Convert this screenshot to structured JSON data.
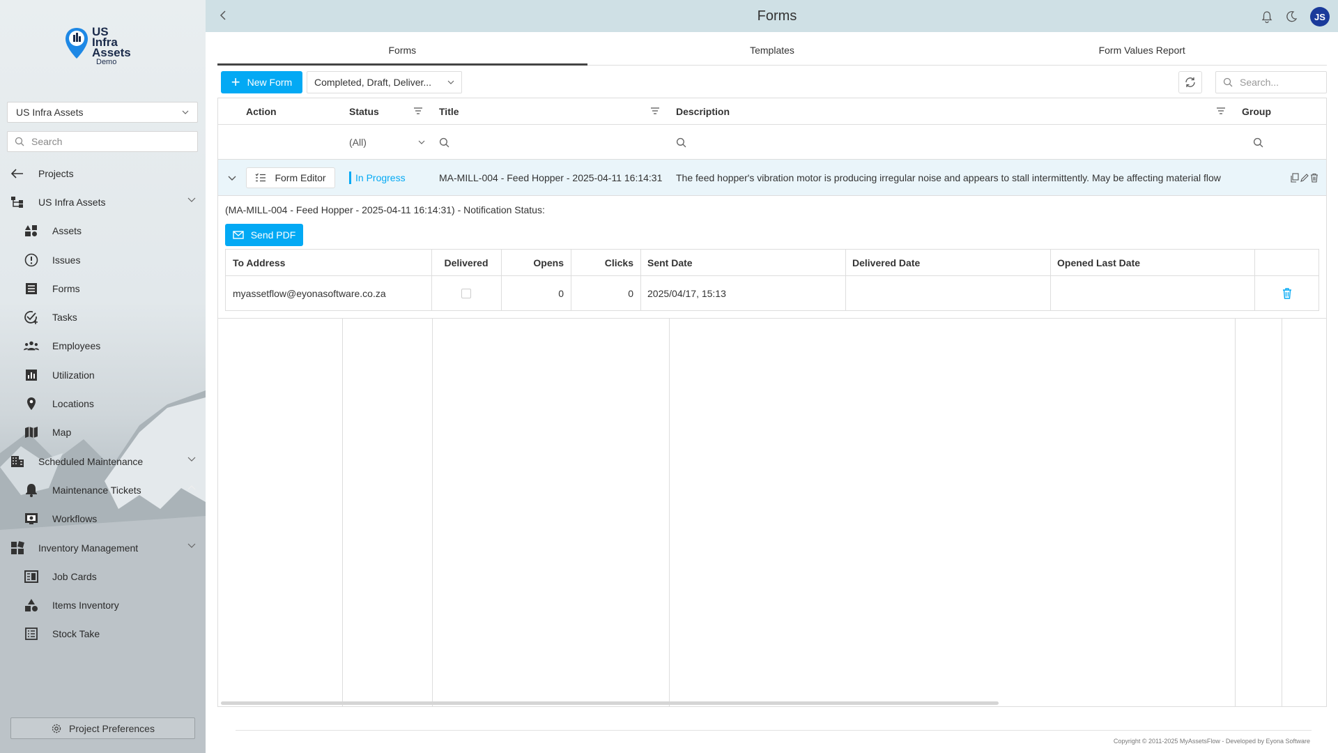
{
  "brand": {
    "line1": "US",
    "line2": "Infra",
    "line3": "Assets",
    "demo": "Demo"
  },
  "sidebar": {
    "project_select": "US Infra Assets",
    "search_placeholder": "Search",
    "items": [
      {
        "label": "Projects",
        "icon": "arrow-left-icon"
      },
      {
        "label": "US Infra Assets",
        "icon": "hierarchy-icon"
      },
      {
        "label": "Assets",
        "icon": "assets-icon"
      },
      {
        "label": "Issues",
        "icon": "alert-circle-icon"
      },
      {
        "label": "Forms",
        "icon": "form-icon"
      },
      {
        "label": "Tasks",
        "icon": "task-icon"
      },
      {
        "label": "Employees",
        "icon": "people-icon"
      },
      {
        "label": "Utilization",
        "icon": "chart-icon"
      },
      {
        "label": "Locations",
        "icon": "location-pin-icon"
      },
      {
        "label": "Map",
        "icon": "map-icon"
      },
      {
        "label": "Scheduled Maintenance",
        "icon": "building-icon"
      },
      {
        "label": "Maintenance Tickets",
        "icon": "bell-icon"
      },
      {
        "label": "Workflows",
        "icon": "workflow-icon"
      },
      {
        "label": "Inventory Management",
        "icon": "grid-icon"
      },
      {
        "label": "Job Cards",
        "icon": "job-card-icon"
      },
      {
        "label": "Items Inventory",
        "icon": "shapes-icon"
      },
      {
        "label": "Stock Take",
        "icon": "list-icon"
      }
    ],
    "preferences_label": "Project Preferences"
  },
  "header": {
    "title": "Forms",
    "avatar_initials": "JS"
  },
  "tabs": [
    {
      "label": "Forms",
      "active": true
    },
    {
      "label": "Templates",
      "active": false
    },
    {
      "label": "Form Values Report",
      "active": false
    }
  ],
  "toolbar": {
    "new_form_label": "New Form",
    "status_filter_value": "Completed, Draft, Deliver...",
    "search_placeholder": "Search..."
  },
  "grid": {
    "columns": {
      "action": "Action",
      "status": "Status",
      "title": "Title",
      "description": "Description",
      "group": "Group"
    },
    "status_filter": "(All)",
    "row": {
      "action_label": "Form Editor",
      "status": "In Progress",
      "title": "MA-MILL-004 - Feed Hopper - 2025-04-11 16:14:31",
      "description": "The feed hopper's vibration motor is producing irregular noise and appears to stall intermittently. May be affecting material flow"
    }
  },
  "notification": {
    "title": "(MA-MILL-004 - Feed Hopper - 2025-04-11 16:14:31) - Notification Status:",
    "send_pdf_label": "Send PDF",
    "columns": {
      "to_address": "To Address",
      "delivered": "Delivered",
      "opens": "Opens",
      "clicks": "Clicks",
      "sent_date": "Sent Date",
      "delivered_date": "Delivered Date",
      "opened_last_date": "Opened Last Date"
    },
    "row": {
      "to_address": "myassetflow@eyonasoftware.co.za",
      "opens": "0",
      "clicks": "0",
      "sent_date": "2025/04/17, 15:13"
    }
  },
  "footer": {
    "copyright": "Copyright © 2011-2025 MyAssetsFlow - Developed by Eyona Software"
  },
  "colors": {
    "accent": "#03a9f4",
    "topbar": "#cfe0e5",
    "avatar": "#1a3a9a"
  }
}
